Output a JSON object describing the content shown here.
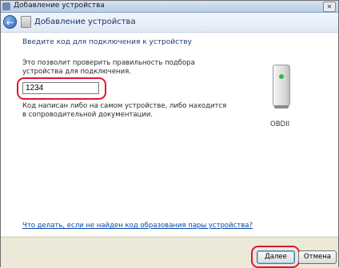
{
  "window": {
    "title": "Добавление устройства",
    "close_icon": "close-icon"
  },
  "header": {
    "back_icon": "back-arrow-icon",
    "title": "Добавление устройства"
  },
  "content": {
    "instruction": "Введите код для подключения к устройству",
    "description": "Это позволит проверить правильность подбора устройства для подключения.",
    "code_value": "1234",
    "hint": "Код написан либо на самом устройстве, либо находится в сопроводительной документации.",
    "device_name": "OBDII",
    "help_link": "Что делать, если не найден код образования пары устройства?"
  },
  "footer": {
    "next_label": "Далее",
    "cancel_label": "Отмена"
  },
  "colors": {
    "highlight": "#e01535",
    "link": "#0645ad",
    "instruction": "#1f3e73"
  }
}
